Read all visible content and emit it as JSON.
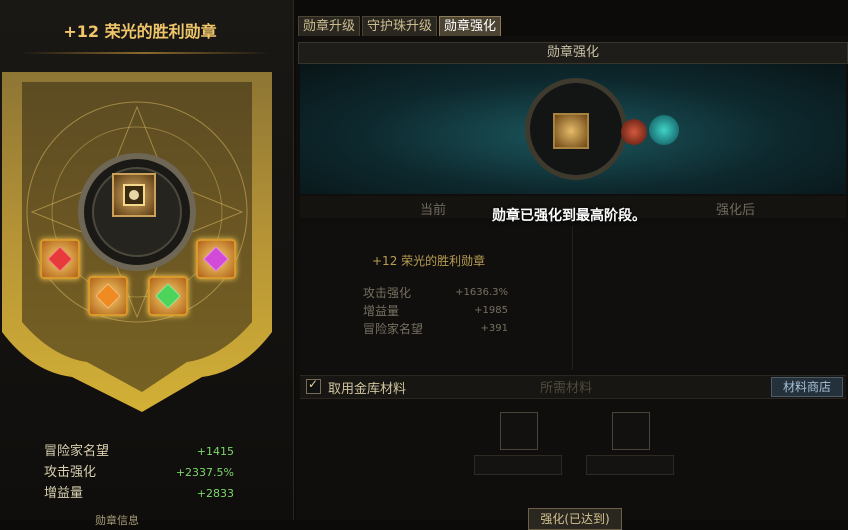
{
  "left_panel": {
    "title": "+12 荣光的胜利勋章",
    "stats": [
      {
        "label": "冒险家名望",
        "value": "+1415"
      },
      {
        "label": "攻击强化",
        "value": "+2337.5%"
      },
      {
        "label": "增益量",
        "value": "+2833"
      }
    ],
    "bottom_text": "勋章信息"
  },
  "tabs": [
    {
      "label": "勋章升级"
    },
    {
      "label": "守护珠升级"
    },
    {
      "label": "勋章强化"
    }
  ],
  "header": {
    "title": "勋章强化"
  },
  "columns": {
    "current": "当前",
    "after": "强化后"
  },
  "notice": "勋章已强化到最高阶段。",
  "current": {
    "name": "+12 荣光的胜利勋章",
    "stats": [
      {
        "label": "攻击强化",
        "value": "+1636.3%"
      },
      {
        "label": "增益量",
        "value": "+1985"
      },
      {
        "label": "冒险家名望",
        "value": "+391"
      }
    ]
  },
  "materials": {
    "checkbox_label": "取用金库材料",
    "title": "所需材料",
    "shop_button": "材料商店"
  },
  "enhance_button": "强化(已达到)",
  "colors": {
    "gold": "#f0c66a",
    "green": "#7cd66b",
    "gem_red": "#e83a3a",
    "gem_green": "#4ed35a",
    "gem_magenta": "#d24ad8",
    "gem_orange": "#f08a22"
  }
}
